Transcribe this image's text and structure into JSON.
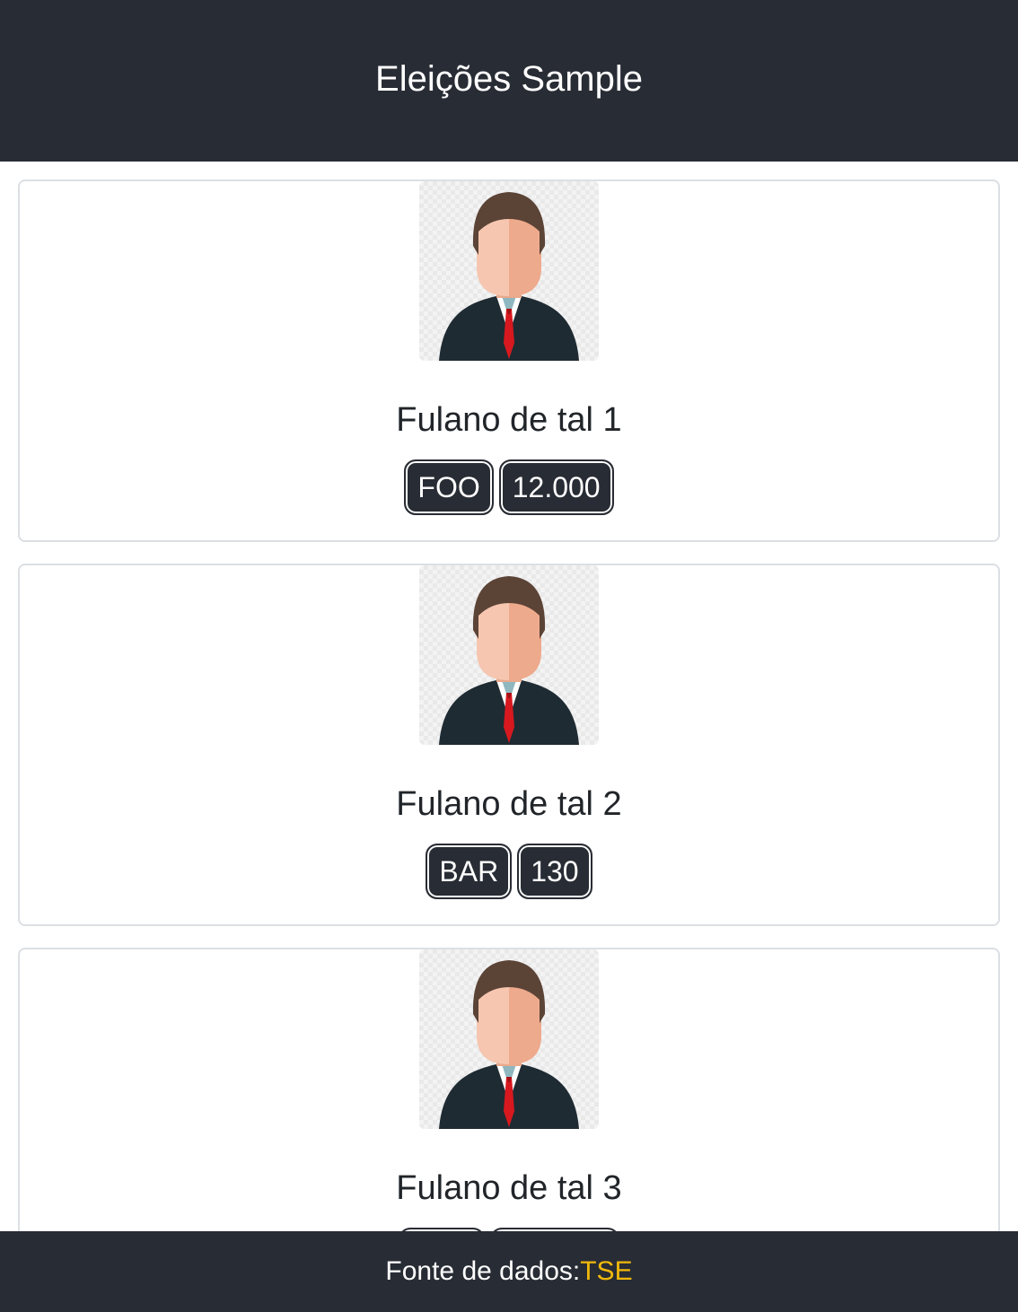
{
  "header": {
    "title": "Eleições Sample"
  },
  "candidates": [
    {
      "name": "Fulano de tal 1",
      "party": "FOO",
      "votes": "12.000",
      "avatar_icon": "businessman-avatar-icon"
    },
    {
      "name": "Fulano de tal 2",
      "party": "BAR",
      "votes": "130",
      "avatar_icon": "businessman-avatar-icon"
    },
    {
      "name": "Fulano de tal 3",
      "party": "",
      "votes": "",
      "avatar_icon": "businessman-avatar-icon"
    }
  ],
  "footer": {
    "source_label": "Fonte de dados:",
    "source_link": "TSE"
  },
  "colors": {
    "header_bg": "#282c34",
    "footer_bg": "#282c34",
    "badge_bg": "#282c34",
    "link_accent": "#f0b90b",
    "card_border": "#dcdfe3"
  }
}
